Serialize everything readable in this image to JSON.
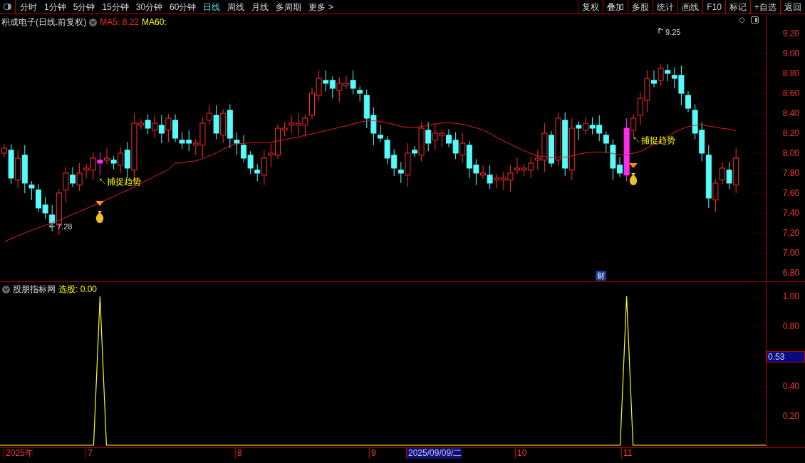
{
  "toolbar": {
    "periods": [
      {
        "label": "分时",
        "selected": false
      },
      {
        "label": "1分钟",
        "selected": false
      },
      {
        "label": "5分钟",
        "selected": false
      },
      {
        "label": "15分钟",
        "selected": false
      },
      {
        "label": "30分钟",
        "selected": false
      },
      {
        "label": "60分钟",
        "selected": false
      },
      {
        "label": "日线",
        "selected": true
      },
      {
        "label": "周线",
        "selected": false
      },
      {
        "label": "月线",
        "selected": false
      },
      {
        "label": "多周期",
        "selected": false
      },
      {
        "label": "更多 >",
        "selected": false
      }
    ],
    "actions": [
      "复权",
      "叠加",
      "多股",
      "统计",
      "画线",
      "F10",
      "标记",
      "+自选",
      "返回"
    ]
  },
  "price_pane": {
    "title": "积成电子(日线.前复权)",
    "ma5": "MA5: 8.22",
    "ma60": "MA60:",
    "high_label": "9.25",
    "low_label": "7.28",
    "signals": [
      "↖捕捉趋势",
      "↖捕捉趋势"
    ],
    "news_badge": "财",
    "axis_ticks": [
      "9.20",
      "9.00",
      "8.80",
      "8.60",
      "8.40",
      "8.20",
      "8.00",
      "7.80",
      "7.60",
      "7.40",
      "7.20",
      "7.00",
      "6.80"
    ]
  },
  "indicator_pane": {
    "name": "股朋指标网",
    "reading": "选股: 0.00",
    "axis_ticks": [
      "1.00",
      "0.80",
      "0.40",
      "0.20"
    ],
    "cursor_value": "0.53"
  },
  "date_axis": [
    {
      "label": "2025年",
      "selected": false
    },
    {
      "label": "7",
      "selected": false
    },
    {
      "label": "8",
      "selected": false
    },
    {
      "label": "9",
      "selected": false
    },
    {
      "label": "2025/09/09/二",
      "selected": true
    },
    {
      "label": "10",
      "selected": false
    },
    {
      "label": "11",
      "selected": false
    }
  ]
}
